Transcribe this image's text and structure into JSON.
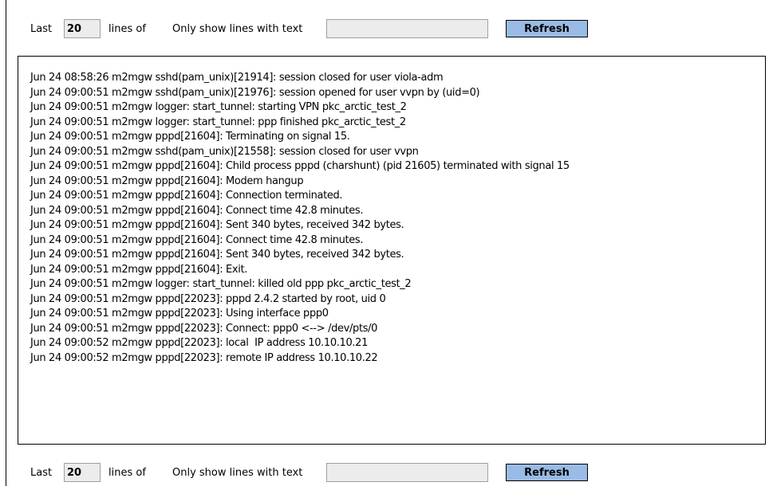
{
  "toolbar": {
    "last_label": "Last",
    "lines_value": "20",
    "lines_of_label": "lines of",
    "filter_label": "Only show lines with text",
    "filter_value": "",
    "refresh_label": "Refresh"
  },
  "log": {
    "lines": [
      "Jun 24 08:58:26 m2mgw sshd(pam_unix)[21914]: session closed for user viola-adm",
      "Jun 24 09:00:51 m2mgw sshd(pam_unix)[21976]: session opened for user vvpn by (uid=0)",
      "Jun 24 09:00:51 m2mgw logger: start_tunnel: starting VPN pkc_arctic_test_2",
      "Jun 24 09:00:51 m2mgw logger: start_tunnel: ppp finished pkc_arctic_test_2",
      "Jun 24 09:00:51 m2mgw pppd[21604]: Terminating on signal 15.",
      "Jun 24 09:00:51 m2mgw sshd(pam_unix)[21558]: session closed for user vvpn",
      "Jun 24 09:00:51 m2mgw pppd[21604]: Child process pppd (charshunt) (pid 21605) terminated with signal 15",
      "Jun 24 09:00:51 m2mgw pppd[21604]: Modem hangup",
      "Jun 24 09:00:51 m2mgw pppd[21604]: Connection terminated.",
      "Jun 24 09:00:51 m2mgw pppd[21604]: Connect time 42.8 minutes.",
      "Jun 24 09:00:51 m2mgw pppd[21604]: Sent 340 bytes, received 342 bytes.",
      "Jun 24 09:00:51 m2mgw pppd[21604]: Connect time 42.8 minutes.",
      "Jun 24 09:00:51 m2mgw pppd[21604]: Sent 340 bytes, received 342 bytes.",
      "Jun 24 09:00:51 m2mgw pppd[21604]: Exit.",
      "Jun 24 09:00:51 m2mgw logger: start_tunnel: killed old ppp pkc_arctic_test_2",
      "Jun 24 09:00:51 m2mgw pppd[22023]: pppd 2.4.2 started by root, uid 0",
      "Jun 24 09:00:51 m2mgw pppd[22023]: Using interface ppp0",
      "Jun 24 09:00:51 m2mgw pppd[22023]: Connect: ppp0 <--> /dev/pts/0",
      "Jun 24 09:00:52 m2mgw pppd[22023]: local  IP address 10.10.10.21",
      "Jun 24 09:00:52 m2mgw pppd[22023]: remote IP address 10.10.10.22"
    ]
  },
  "colors": {
    "button_background": "#99bbe5",
    "input_background": "#ececec"
  }
}
